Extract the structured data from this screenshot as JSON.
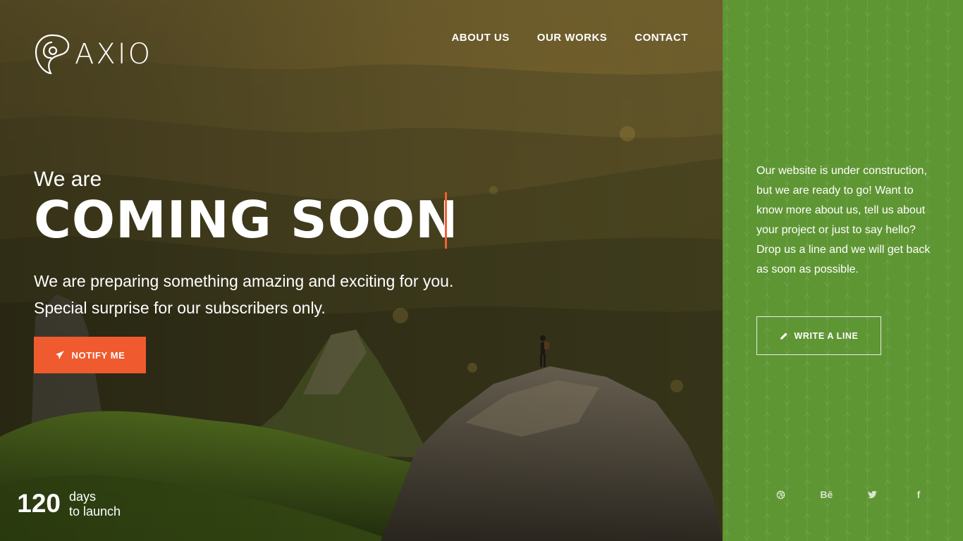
{
  "brand": {
    "name": "AXIO"
  },
  "nav": {
    "items": [
      "ABOUT US",
      "OUR WORKS",
      "CONTACT"
    ]
  },
  "hero": {
    "kicker": "We are",
    "headline": "COMING SOON",
    "subtitle": "We are preparing something amazing and exciting for you. Special surprise for our subscribers only.",
    "cta_label": "NOTIFY ME",
    "cta_icon": "paper-plane-icon"
  },
  "countdown": {
    "value": "120",
    "unit_line1": "days",
    "unit_line2": "to launch"
  },
  "panel": {
    "text": "Our website is under construction, but we are ready to go! Want to know more about us, tell us about your project or just to say hello? Drop us a line and we will get back as soon as possible.",
    "button_label": "WRITE A LINE",
    "button_icon": "pencil-icon",
    "social": [
      {
        "name": "dribbble-icon",
        "glyph": ""
      },
      {
        "name": "behance-icon",
        "glyph": "Bē"
      },
      {
        "name": "twitter-icon",
        "glyph": ""
      },
      {
        "name": "facebook-icon",
        "glyph": "f"
      }
    ]
  },
  "colors": {
    "accent": "#f05a2f",
    "panel": "#5f9634",
    "text": "#ffffff"
  }
}
